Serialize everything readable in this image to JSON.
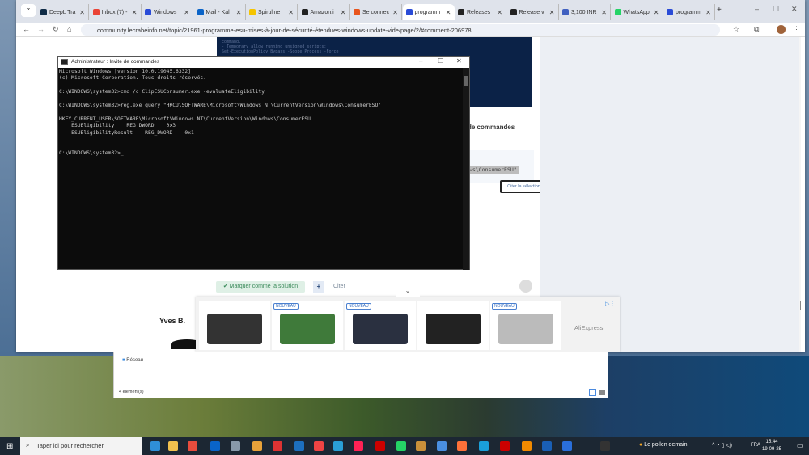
{
  "browser": {
    "tabs": [
      {
        "label": "DeepL Tra",
        "color": "#0f2b46"
      },
      {
        "label": "Inbox (7) -",
        "color": "#ea4335"
      },
      {
        "label": "Windows",
        "color": "#2a4bd7"
      },
      {
        "label": "Mail - Kal",
        "color": "#0a64c8"
      },
      {
        "label": "Spiruline",
        "color": "#f5c400"
      },
      {
        "label": "Amazon.i",
        "color": "#222"
      },
      {
        "label": "Se connec",
        "color": "#e8541c"
      },
      {
        "label": "programm",
        "color": "#2a4bd7",
        "active": true
      },
      {
        "label": "Releases",
        "color": "#222"
      },
      {
        "label": "Release v",
        "color": "#222"
      },
      {
        "label": "3,100 INR",
        "color": "#4060c0"
      },
      {
        "label": "WhatsApp",
        "color": "#25d366"
      },
      {
        "label": "programm",
        "color": "#2a4bd7"
      }
    ],
    "url": "community.lecrabeinfo.net/topic/21961-programme-esu-mises-à-jour-de-sécurité-étendues-windows-update-vide/page/2/#comment-206978"
  },
  "page": {
    "dark_code_lines": [
      "command.",
      "- Temporary allow running unsigned scripts:",
      "Set-ExecutionPolicy Bypass -Scope Process -Force"
    ],
    "heading_fragment": "de commandes",
    "selected_text": "ws\\ConsumerESU\"",
    "quote_tooltip": "Citer la sélection",
    "mark_solution": "✔ Marquer comme la solution",
    "plus": "+",
    "cite": "Citer",
    "author": "Yves B.",
    "ad": {
      "badge": "NOUVEAU",
      "brand": "AliExpress",
      "products": [
        {
          "new": false,
          "color": "#333"
        },
        {
          "new": true,
          "color": "#3f7a3a"
        },
        {
          "new": true,
          "color": "#2a3040"
        },
        {
          "new": false,
          "color": "#222"
        },
        {
          "new": true,
          "color": "#bbb"
        }
      ]
    }
  },
  "cmd": {
    "title": "Administrateur : Invite de commandes",
    "output": "Microsoft Windows [version 10.0.19045.6332]\n(c) Microsoft Corporation. Tous droits réservés.\n\nC:\\WINDOWS\\system32>cmd /c ClipESUConsumer.exe -evaluateEligibility\n\nC:\\WINDOWS\\system32>reg.exe query \"HKCU\\SOFTWARE\\Microsoft\\Windows NT\\CurrentVersion\\Windows\\ConsumerESU\"\n\nHKEY_CURRENT_USER\\SOFTWARE\\Microsoft\\Windows NT\\CurrentVersion\\Windows\\ConsumerESU\n    ESUEligibility    REG_DWORD    0x3\n    ESUEligibilityResult    REG_DWORD    0x1\n\n\nC:\\WINDOWS\\system32>_"
  },
  "explorer": {
    "item": "Réseau",
    "status": "4 élément(s)"
  },
  "taskbar": {
    "search_placeholder": "Taper ici pour rechercher",
    "apps": [
      "#2f8fd8",
      "#f2c14e",
      "#e84c3d",
      "#0a64c8",
      "#8899aa",
      "#e8a23a",
      "#d33",
      "#1d6fbf",
      "#e44",
      "#2a9fd6",
      "#f25",
      "#c00",
      "#25d366",
      "#c9903a",
      "#4a8fe0",
      "#ff7139",
      "#1a9fd9",
      "#c00",
      "#f08a00",
      "#1a5fb4",
      "#2a6fdb",
      "#333"
    ],
    "weather": "Le pollen demain",
    "lang": "FRA",
    "time": "15:44",
    "date": "19-09-25"
  }
}
